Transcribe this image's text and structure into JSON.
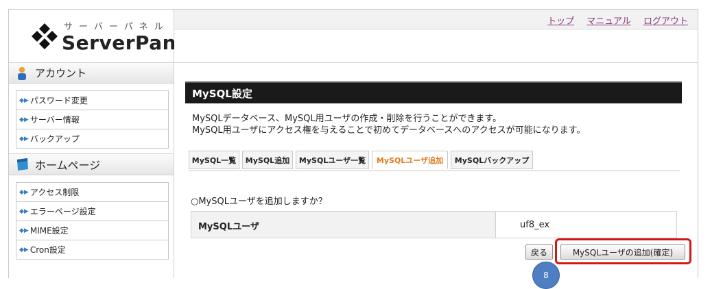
{
  "logo": {
    "kana": "サーバーパネル",
    "text": "ServerPanel"
  },
  "top_links": [
    "トップ",
    "マニュアル",
    "ログアウト"
  ],
  "sidebar": {
    "account": {
      "heading": "アカウント",
      "items": [
        "パスワード変更",
        "サーバー情報",
        "バックアップ"
      ]
    },
    "homepage": {
      "heading": "ホームページ",
      "items": [
        "アクセス制限",
        "エラーページ設定",
        "MIME設定",
        "Cron設定"
      ]
    },
    "item_marker": "◆▶"
  },
  "main": {
    "title": "MySQL設定",
    "description_line1": "MySQLデータベース、MySQL用ユーザの作成・削除を行うことができます。",
    "description_line2": "MySQL用ユーザにアクセス権を与えることで初めてデータベースへのアクセスが可能になります。",
    "tabs": [
      {
        "label": "MySQL一覧",
        "active": false
      },
      {
        "label": "MySQL追加",
        "active": false
      },
      {
        "label": "MySQLユーザ一覧",
        "active": false
      },
      {
        "label": "MySQLユーザ追加",
        "active": true
      },
      {
        "label": "MySQLバックアップ",
        "active": false
      }
    ],
    "question": "○MySQLユーザを追加しますか？",
    "form": {
      "label": "MySQLユーザ",
      "value": "uf8_ex"
    },
    "back_button": "戻る",
    "confirm_button": "MySQLユーザの追加(確定)"
  },
  "annotation": {
    "step": "8",
    "highlight_color": "#d41616",
    "badge_color": "#4f7fc2"
  },
  "colors": {
    "link": "#8a3a7a",
    "active_tab": "#e07b1c",
    "title_bar": "#1a1a1a"
  }
}
